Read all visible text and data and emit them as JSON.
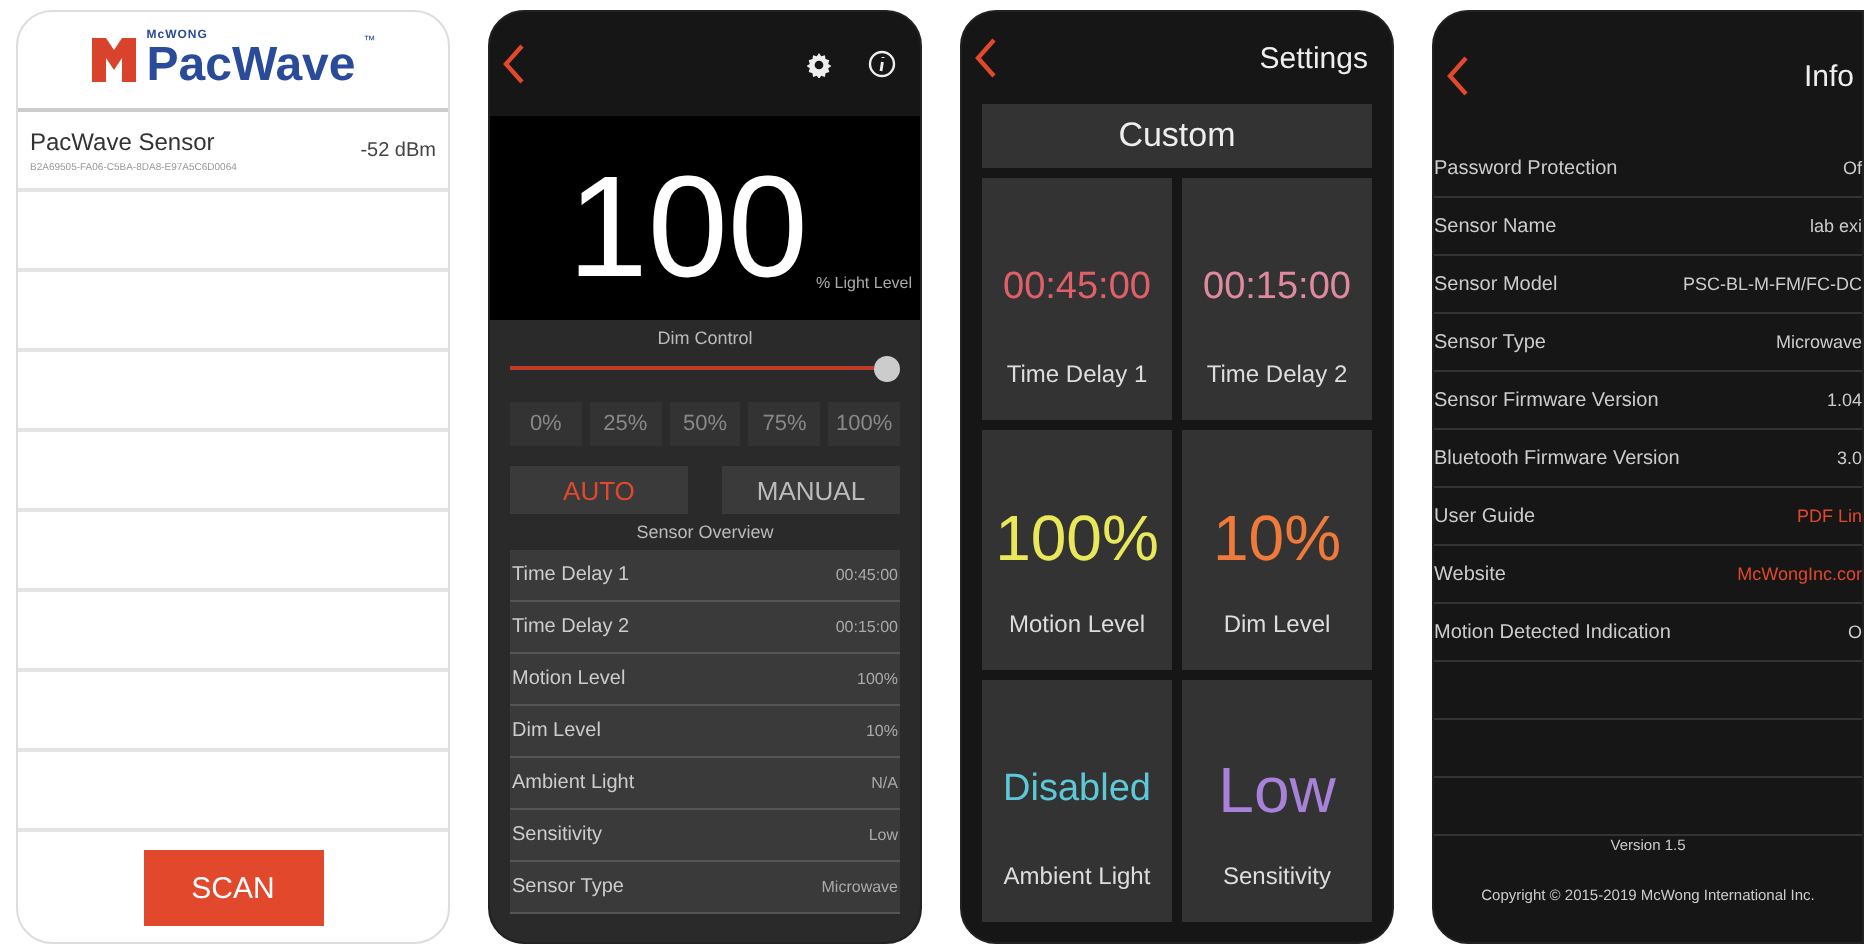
{
  "scan_screen": {
    "brand": {
      "maker": "McWONG",
      "product": "PacWave",
      "trademark": "™"
    },
    "devices": [
      {
        "name": "PacWave Sensor",
        "id": "B2A69505-FA06-C5BA-8DA8-E97A5C6D0064",
        "signal": "-52 dBm"
      }
    ],
    "scan_button": "SCAN"
  },
  "dashboard": {
    "light_value": "100",
    "light_unit": "% Light Level",
    "dim_label": "Dim Control",
    "dim_slider": {
      "level": 1.0
    },
    "presets": [
      {
        "label": "0%",
        "selected": false
      },
      {
        "label": "25%",
        "selected": false
      },
      {
        "label": "50%",
        "selected": false
      },
      {
        "label": "75%",
        "selected": false
      },
      {
        "label": "100%",
        "selected": false
      }
    ],
    "modes": [
      {
        "label": "AUTO",
        "selected": true
      },
      {
        "label": "MANUAL",
        "selected": false
      }
    ],
    "overview_title": "Sensor Overview",
    "overview": [
      {
        "label": "Time Delay 1",
        "value": "00:45:00"
      },
      {
        "label": "Time Delay 2",
        "value": "00:15:00"
      },
      {
        "label": "Motion Level",
        "value": "100%"
      },
      {
        "label": "Dim Level",
        "value": "10%"
      },
      {
        "label": "Ambient Light",
        "value": "N/A"
      },
      {
        "label": "Sensitivity",
        "value": "Low"
      },
      {
        "label": "Sensor Type",
        "value": "Microwave"
      }
    ]
  },
  "settings_screen": {
    "title": "Settings",
    "profile": "Custom",
    "tiles": [
      {
        "value": "00:45:00",
        "label": "Time Delay 1",
        "color": "#e0606a"
      },
      {
        "value": "00:15:00",
        "label": "Time Delay 2",
        "color": "#e08aa0"
      },
      {
        "value": "100%",
        "label": "Motion Level",
        "color": "#e8e85a"
      },
      {
        "value": "10%",
        "label": "Dim Level",
        "color": "#f07a3a"
      },
      {
        "value": "Disabled",
        "label": "Ambient Light",
        "color": "#5cc8d8"
      },
      {
        "value": "Low",
        "label": "Sensitivity",
        "color": "#a882d8"
      }
    ]
  },
  "info_screen": {
    "title": "Info",
    "rows": [
      {
        "label": "Password Protection",
        "value": "Of",
        "kind": "text"
      },
      {
        "label": "Sensor Name",
        "value": "lab exi",
        "kind": "text"
      },
      {
        "label": "Sensor Model",
        "value": "PSC-BL-M-FM/FC-DC",
        "kind": "text"
      },
      {
        "label": "Sensor Type",
        "value": "Microwave",
        "kind": "text"
      },
      {
        "label": "Sensor Firmware Version",
        "value": "1.04",
        "kind": "text"
      },
      {
        "label": "Bluetooth Firmware Version",
        "value": "3.0",
        "kind": "text"
      },
      {
        "label": "User Guide",
        "value": "PDF Lin",
        "kind": "link"
      },
      {
        "label": "Website",
        "value": "McWongInc.cor",
        "kind": "link"
      },
      {
        "label": "Motion Detected Indication",
        "value": "O",
        "kind": "text"
      }
    ],
    "version": "Version 1.5",
    "copyright": "Copyright © 2015-2019 McWong International Inc."
  }
}
